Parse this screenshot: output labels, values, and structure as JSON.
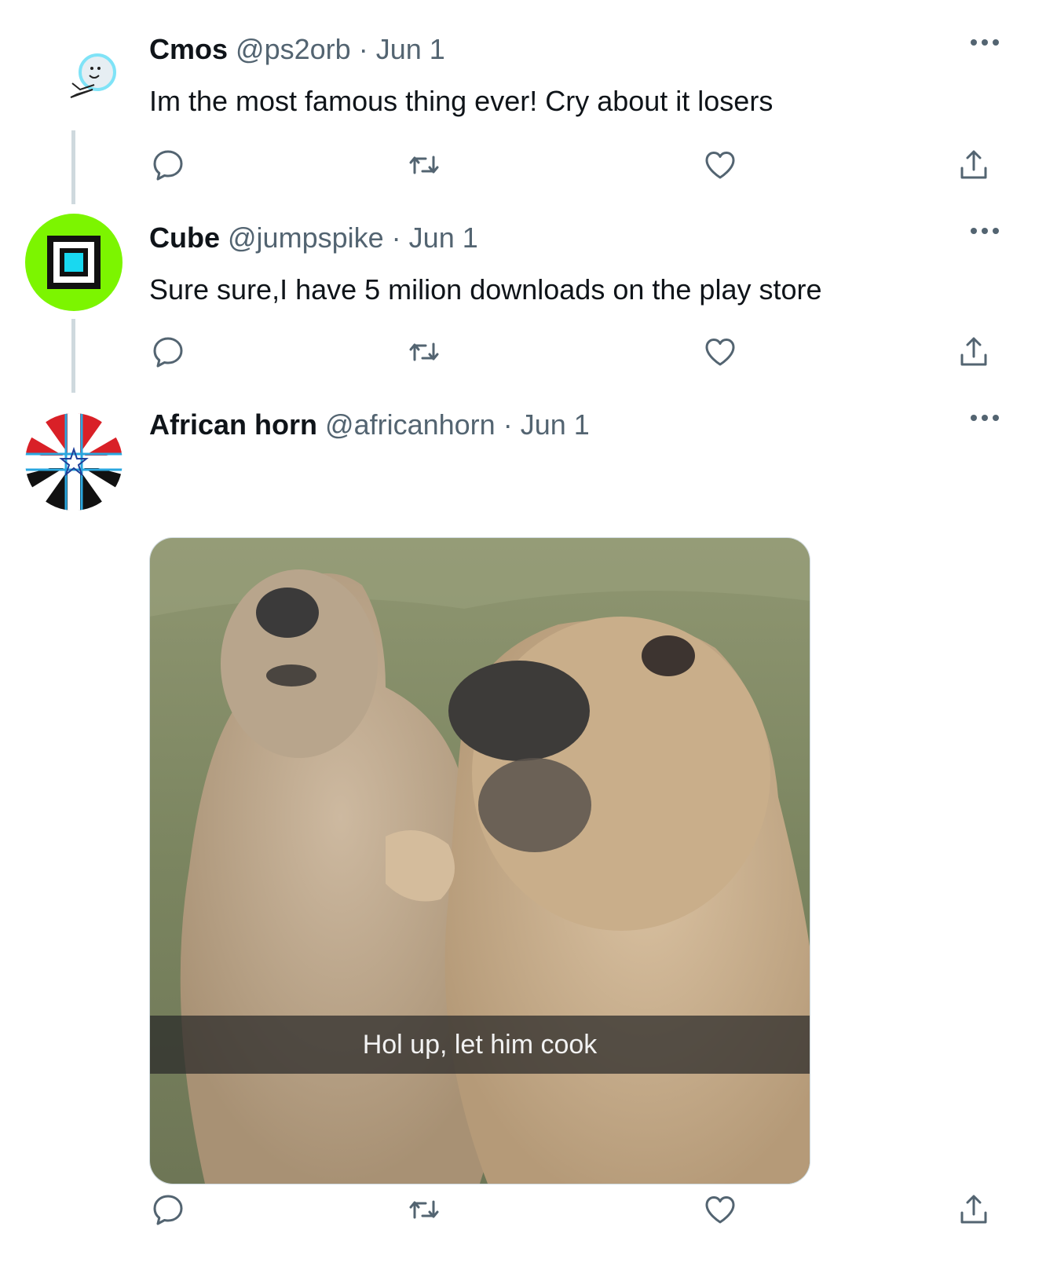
{
  "tweets": [
    {
      "name": "Cmos",
      "handle": "@ps2orb",
      "sep": "·",
      "date": "Jun 1",
      "text": "Im the most famous thing ever! Cry about it losers",
      "avatar_icon": "orb-character-avatar"
    },
    {
      "name": "Cube",
      "handle": "@jumpspike",
      "sep": "·",
      "date": "Jun 1",
      "text": "Sure sure,I have 5 milion downloads on the play store",
      "avatar_icon": "square-cube-avatar"
    },
    {
      "name": "African horn",
      "handle": "@africanhorn",
      "sep": "·",
      "date": "Jun 1",
      "text": "",
      "avatar_icon": "flag-avatar",
      "media": {
        "caption": "Hol up, let him cook",
        "description_icon": "marmots-photo"
      }
    }
  ],
  "actions": [
    "reply-icon",
    "retweet-icon",
    "like-icon",
    "share-icon"
  ],
  "colors": {
    "text_primary": "#0f1419",
    "text_secondary": "#536471",
    "thread_line": "#cfd9de",
    "cube_green": "#7cf500",
    "cube_cyan": "#19d8f0"
  }
}
